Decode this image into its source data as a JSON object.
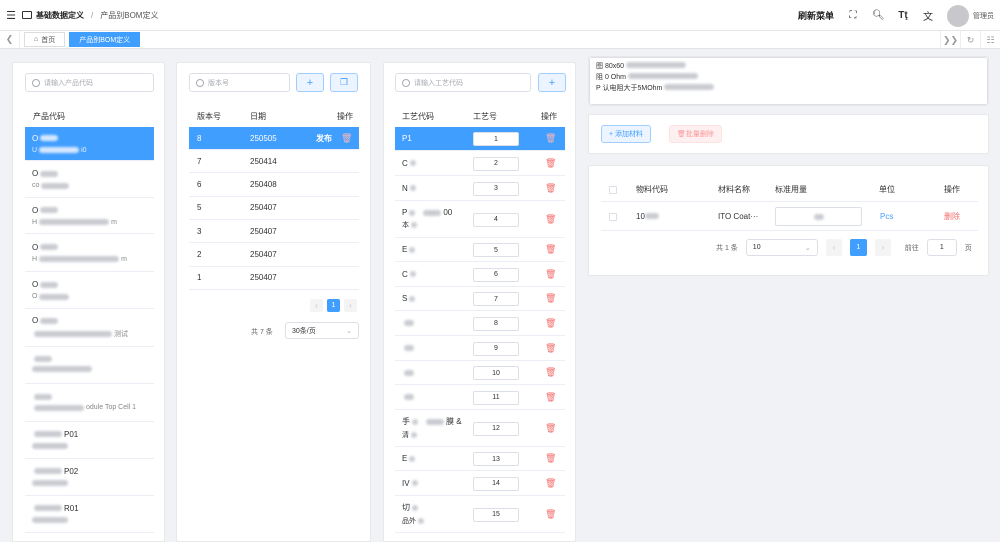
{
  "header": {
    "breadcrumb_root": "基础数据定义",
    "breadcrumb_current": "产品别BOM定义",
    "refresh_menu": "刷新菜单",
    "username": "管理员"
  },
  "tags": {
    "home": "首页",
    "current": "产品别BOM定义"
  },
  "product_panel": {
    "search_placeholder": "请输入产品代码",
    "column": "产品代码",
    "items": [
      {
        "title": "O",
        "sub": "U",
        "suffix": "i0"
      },
      {
        "title": "O",
        "sub": "co",
        "suffix": ""
      },
      {
        "title": "O",
        "sub": "H",
        "suffix": "m"
      },
      {
        "title": "O",
        "sub": "H",
        "suffix": "m"
      },
      {
        "title": "O",
        "sub": "O",
        "suffix": ""
      },
      {
        "title": "O",
        "sub": "",
        "suffix": "测试"
      },
      {
        "title": "",
        "sub": "",
        "suffix": ""
      },
      {
        "title": "",
        "sub": "",
        "suffix": "odule Top Cell 1"
      },
      {
        "title": "",
        "sub": "",
        "suffix": "P01"
      },
      {
        "title": "",
        "sub": "",
        "suffix": "P02"
      },
      {
        "title": "",
        "sub": "",
        "suffix": "R01"
      }
    ]
  },
  "version_panel": {
    "search_placeholder": "版本号",
    "col_version": "版本号",
    "col_date": "日期",
    "col_op": "操作",
    "rows": [
      {
        "version": "8",
        "date": "250505",
        "op": "发布"
      },
      {
        "version": "7",
        "date": "250414",
        "op": ""
      },
      {
        "version": "6",
        "date": "250408",
        "op": ""
      },
      {
        "version": "5",
        "date": "250407",
        "op": ""
      },
      {
        "version": "3",
        "date": "250407",
        "op": ""
      },
      {
        "version": "2",
        "date": "250407",
        "op": ""
      },
      {
        "version": "1",
        "date": "250407",
        "op": ""
      }
    ],
    "total": "共 7 条",
    "page_size": "30条/页",
    "page": "1"
  },
  "process_panel": {
    "search_placeholder": "请输入工艺代码",
    "col_code": "工艺代码",
    "col_no": "工艺号",
    "col_op": "操作",
    "rows": [
      {
        "code": "P1",
        "no": "1"
      },
      {
        "code": "C",
        "no": "2"
      },
      {
        "code": "N",
        "no": "3"
      },
      {
        "code": "P",
        "extra": "00",
        "code2": "本",
        "no": "4"
      },
      {
        "code": "E",
        "no": "5"
      },
      {
        "code": "C",
        "no": "6"
      },
      {
        "code": "S",
        "no": "7"
      },
      {
        "code": "",
        "no": "8"
      },
      {
        "code": "",
        "no": "9"
      },
      {
        "code": "",
        "no": "10"
      },
      {
        "code": "",
        "no": "11"
      },
      {
        "code": "手",
        "extra": "膜 &",
        "code2": "清",
        "no": "12"
      },
      {
        "code": "E",
        "no": "13"
      },
      {
        "code": "IV",
        "no": "14"
      },
      {
        "code": "切",
        "code2": "品外",
        "no": "15"
      }
    ]
  },
  "detail": {
    "desc_lines": [
      "图 80x60",
      "阻 0 Ohm",
      "P 认电阻大于5MOhm"
    ],
    "add_material": "+ 添加材料",
    "batch_delete": "批量删除",
    "col_code": "物料代码",
    "col_name": "材料名称",
    "col_qty": "标准用量",
    "col_unit": "单位",
    "col_op": "操作",
    "rows": [
      {
        "code": "10",
        "name": "ITO Coat···",
        "unit": "Pcs",
        "op": "删除"
      }
    ],
    "total": "共 1 条",
    "page_size": "10",
    "page": "1",
    "goto": "前往",
    "goto_value": "1",
    "page_unit": "页"
  },
  "colors": {
    "accent": "#409eff",
    "danger": "#f56c6c"
  }
}
